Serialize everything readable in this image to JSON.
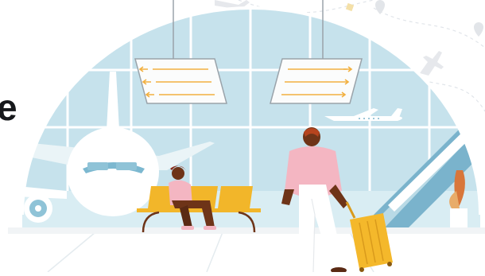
{
  "banner": {
    "headline_fragment": "e",
    "scene": "airport-terminal-illustration",
    "colors": {
      "background": "#ffffff",
      "window_sky": "#c6e2ec",
      "window_frame": "#ffffff",
      "floor": "#f1f4f6",
      "seat": "#f2b62a",
      "suitcase": "#f4b82b",
      "shirt": "#f4b6c2",
      "trousers": "#ffffff",
      "skin": "#6e3418",
      "escalator": "#7ab3cc",
      "board": "#fbfcfc",
      "board_text": "#f2b040",
      "hair": "#8c2c1a",
      "accent_orange": "#d8763a"
    },
    "icons": [
      "airplane-icon",
      "departure-board-icon",
      "escalator-icon",
      "plant-icon",
      "map-pin-icon",
      "suitcase-icon"
    ]
  }
}
